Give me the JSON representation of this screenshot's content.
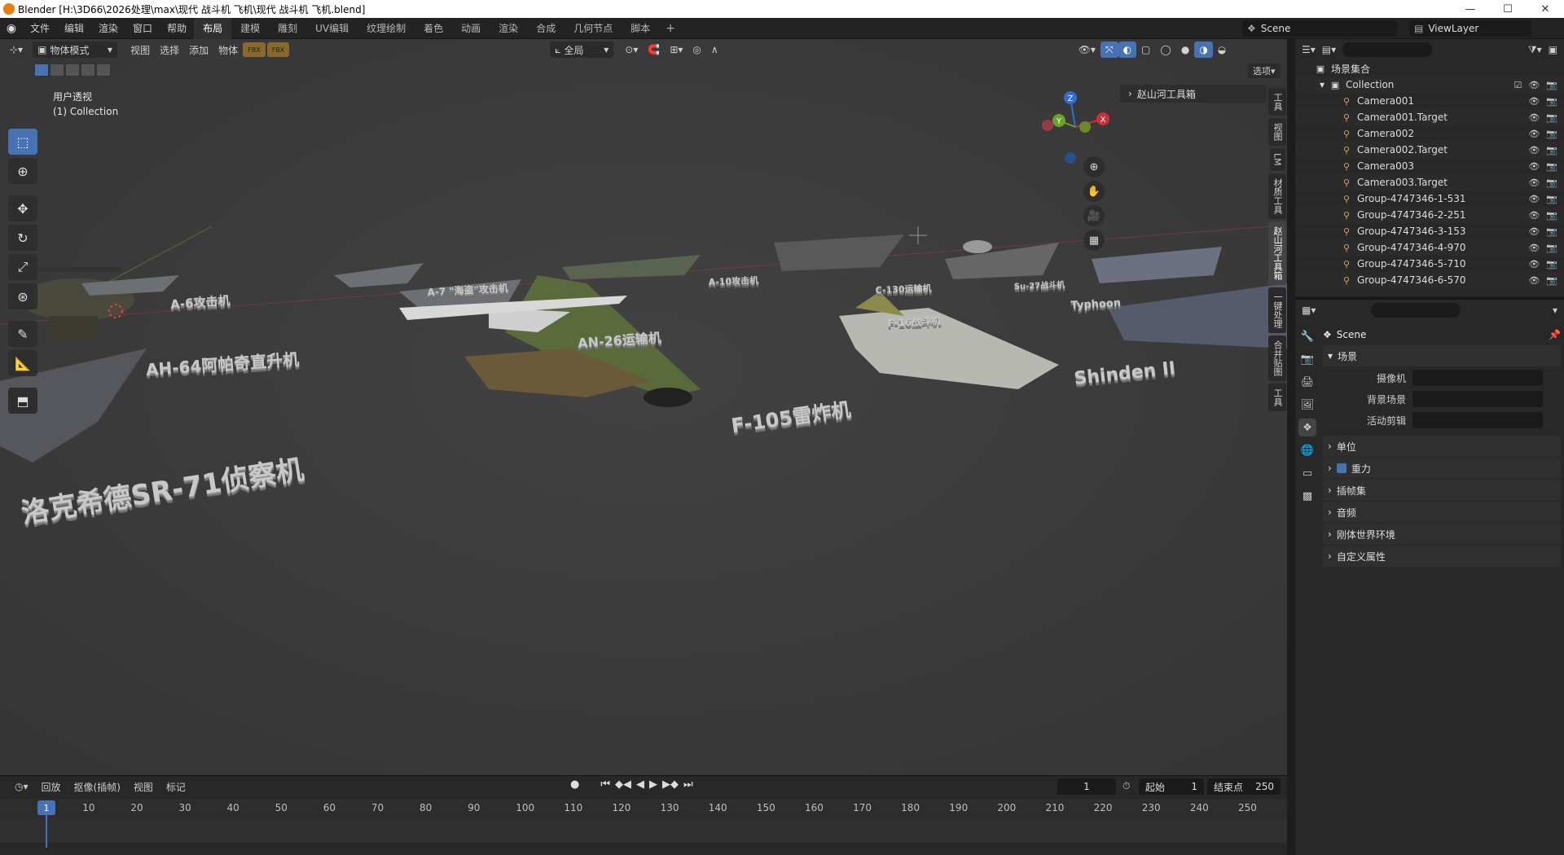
{
  "window": {
    "title": "Blender [H:\\3D66\\2026处理\\max\\现代 战斗机 飞机\\现代 战斗机 飞机.blend]"
  },
  "menu": [
    "文件",
    "编辑",
    "渲染",
    "窗口",
    "帮助"
  ],
  "workspaces": [
    "布局",
    "建模",
    "雕刻",
    "UV编辑",
    "纹理绘制",
    "着色",
    "动画",
    "渲染",
    "合成",
    "几何节点",
    "脚本"
  ],
  "active_workspace": "布局",
  "scene_name": "Scene",
  "view_layer": "ViewLayer",
  "viewport": {
    "mode": "物体模式",
    "menus": [
      "视图",
      "选择",
      "添加",
      "物体"
    ],
    "transform": "全局",
    "options": "选项",
    "info_line1": "用户透视",
    "info_line2": "(1) Collection",
    "tool_panel": "赵山河工具箱",
    "side_tabs": [
      "工具",
      "视图",
      "LM",
      "材质工具",
      "赵山河工具箱",
      "一键处理",
      "合并贴图",
      "工具"
    ],
    "gizmo_axes": {
      "z": "Z",
      "y": "Y",
      "x": "X"
    },
    "labels": [
      {
        "text": "A-6攻击机"
      },
      {
        "text": "A-7 \"海盗\"攻击机"
      },
      {
        "text": "A-10攻击机"
      },
      {
        "text": "AH-64阿帕奇直升机"
      },
      {
        "text": "AN-26运输机"
      },
      {
        "text": "F-105雷炸机"
      },
      {
        "text": "洛克希德SR-71侦察机"
      },
      {
        "text": "Shinden II"
      },
      {
        "text": "Typhoon"
      },
      {
        "text": "C-130运输机"
      },
      {
        "text": "F-16战斗机"
      },
      {
        "text": "Su-27战斗机"
      }
    ]
  },
  "outliner": {
    "root": "场景集合",
    "collection": "Collection",
    "items": [
      "Camera001",
      "Camera001.Target",
      "Camera002",
      "Camera002.Target",
      "Camera003",
      "Camera003.Target",
      "Group-4747346-1-531",
      "Group-4747346-2-251",
      "Group-4747346-3-153",
      "Group-4747346-4-970",
      "Group-4747346-5-710",
      "Group-4747346-6-570"
    ]
  },
  "properties": {
    "header": "Scene",
    "section_scene": "场景",
    "fields": [
      {
        "label": "摄像机"
      },
      {
        "label": "背景场景"
      },
      {
        "label": "活动剪辑"
      }
    ],
    "sections": [
      "单位",
      "重力",
      "插帧集",
      "音频",
      "刚体世界环境",
      "自定义属性"
    ]
  },
  "timeline": {
    "menus": [
      "回放",
      "抠像(插帧)",
      "视图",
      "标记"
    ],
    "current_frame": "1",
    "start_label": "起始",
    "start": "1",
    "end_label": "结束点",
    "end": "250",
    "ticks": [
      "1",
      "10",
      "20",
      "30",
      "40",
      "50",
      "60",
      "70",
      "80",
      "90",
      "100",
      "110",
      "120",
      "130",
      "140",
      "150",
      "160",
      "170",
      "180",
      "190",
      "200",
      "210",
      "220",
      "230",
      "240",
      "250"
    ]
  },
  "colors": {
    "accent": "#4772b3",
    "viewport_bg": "#3c3c3c",
    "panel_bg": "#282828"
  }
}
